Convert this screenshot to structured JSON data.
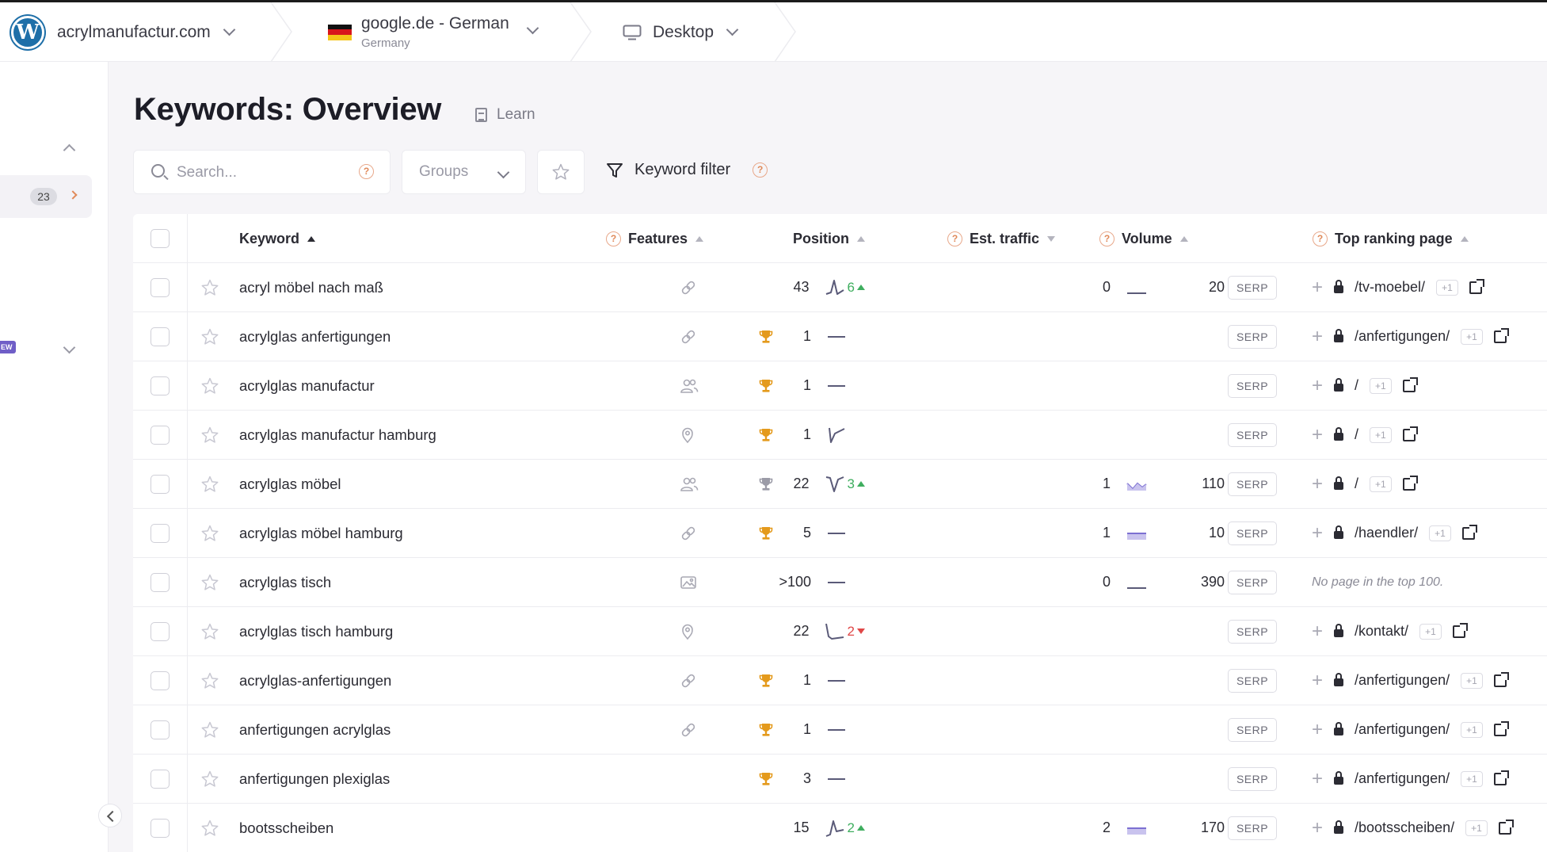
{
  "topbar": {
    "site": "acrylmanufactur.com",
    "engine": "google.de - German",
    "country": "Germany",
    "device": "Desktop"
  },
  "sidebar": {
    "badge": "23",
    "new_label": "EW"
  },
  "page": {
    "title": "Keywords: Overview",
    "learn": "Learn"
  },
  "controls": {
    "search_placeholder": "Search...",
    "groups": "Groups",
    "keyword_filter": "Keyword filter"
  },
  "table": {
    "headers": {
      "keyword": "Keyword",
      "features": "Features",
      "position": "Position",
      "traffic": "Est. traffic",
      "volume": "Volume",
      "top_page": "Top ranking page"
    },
    "serp_label": "SERP",
    "plus_one": "+1",
    "rows": [
      {
        "keyword": "acryl möbel nach maß",
        "feature_icon": "link-icon",
        "trophy": "",
        "position": "43",
        "trend": "peak",
        "change": "6",
        "change_dir": "up",
        "traffic": "0",
        "traffic_level": 0,
        "volume": "20",
        "vol_bars": 5,
        "page": "/tv-moebel/"
      },
      {
        "keyword": "acrylglas anfertigungen",
        "feature_icon": "link-icon",
        "trophy": "gold",
        "position": "1",
        "trend": "flat",
        "change": "",
        "change_dir": "",
        "traffic": "",
        "traffic_level": null,
        "volume": "",
        "vol_bars": 0,
        "page": "/anfertigungen/"
      },
      {
        "keyword": "acrylglas manufactur",
        "feature_icon": "people-icon",
        "trophy": "gold",
        "position": "1",
        "trend": "flat",
        "change": "",
        "change_dir": "",
        "traffic": "",
        "traffic_level": null,
        "volume": "",
        "vol_bars": 0,
        "page": "/"
      },
      {
        "keyword": "acrylglas manufactur hamburg",
        "feature_icon": "pin-icon",
        "trophy": "gold",
        "position": "1",
        "trend": "drop-recover",
        "change": "",
        "change_dir": "",
        "traffic": "",
        "traffic_level": null,
        "volume": "",
        "vol_bars": 0,
        "page": "/"
      },
      {
        "keyword": "acrylglas möbel",
        "feature_icon": "people-icon",
        "trophy": "silver",
        "position": "22",
        "trend": "valley",
        "change": "3",
        "change_dir": "up",
        "traffic": "1",
        "traffic_level": 1,
        "volume": "110",
        "vol_bars": 4,
        "page": "/"
      },
      {
        "keyword": "acrylglas möbel hamburg",
        "feature_icon": "link-icon",
        "trophy": "gold",
        "position": "5",
        "trend": "flat",
        "change": "",
        "change_dir": "",
        "traffic": "1",
        "traffic_level": 2,
        "volume": "10",
        "vol_bars": 5,
        "page": "/haendler/"
      },
      {
        "keyword": "acrylglas tisch",
        "feature_icon": "image-icon",
        "trophy": "",
        "position": ">100",
        "trend": "flat",
        "change": "",
        "change_dir": "",
        "traffic": "0",
        "traffic_level": 0,
        "volume": "390",
        "vol_bars": 4,
        "page": ""
      },
      {
        "keyword": "acrylglas tisch hamburg",
        "feature_icon": "pin-icon",
        "trophy": "",
        "position": "22",
        "trend": "dip",
        "change": "2",
        "change_dir": "down",
        "traffic": "",
        "traffic_level": null,
        "volume": "",
        "vol_bars": 0,
        "page": "/kontakt/"
      },
      {
        "keyword": "acrylglas-anfertigungen",
        "feature_icon": "link-icon",
        "trophy": "gold",
        "position": "1",
        "trend": "flat",
        "change": "",
        "change_dir": "",
        "traffic": "",
        "traffic_level": null,
        "volume": "",
        "vol_bars": 0,
        "page": "/anfertigungen/"
      },
      {
        "keyword": "anfertigungen acrylglas",
        "feature_icon": "link-icon",
        "trophy": "gold",
        "position": "1",
        "trend": "flat",
        "change": "",
        "change_dir": "",
        "traffic": "",
        "traffic_level": null,
        "volume": "",
        "vol_bars": 0,
        "page": "/anfertigungen/"
      },
      {
        "keyword": "anfertigungen plexiglas",
        "feature_icon": "",
        "trophy": "gold",
        "position": "3",
        "trend": "flat",
        "change": "",
        "change_dir": "",
        "traffic": "",
        "traffic_level": null,
        "volume": "",
        "vol_bars": 0,
        "page": "/anfertigungen/"
      },
      {
        "keyword": "bootsscheiben",
        "feature_icon": "",
        "trophy": "",
        "position": "15",
        "trend": "rise",
        "change": "2",
        "change_dir": "up",
        "traffic": "2",
        "traffic_level": 2,
        "volume": "170",
        "vol_bars": 3,
        "page": "/bootsscheiben/"
      }
    ],
    "no_page_text": "No page in the top 100."
  },
  "colors": {
    "accent": "#6f5ec7",
    "orange": "#e08a5a",
    "gold": "#e49a1c",
    "up": "#3fae5f",
    "down": "#e04848"
  }
}
